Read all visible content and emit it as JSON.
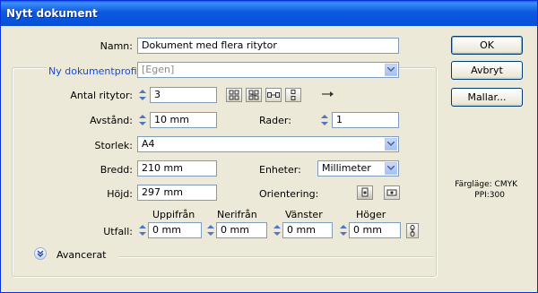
{
  "window": {
    "title": "Nytt dokument"
  },
  "name": {
    "label": "Namn:",
    "value": "Dokument med flera ritytor"
  },
  "profile": {
    "label": "Ny dokumentprofil:",
    "value": "[Egen]"
  },
  "artboards": {
    "label": "Antal ritytor:",
    "value": "3"
  },
  "spacing": {
    "label": "Avstånd:",
    "value": "10 mm"
  },
  "rows": {
    "label": "Rader:",
    "value": "1"
  },
  "size": {
    "label": "Storlek:",
    "value": "A4"
  },
  "width": {
    "label": "Bredd:",
    "value": "210 mm"
  },
  "units": {
    "label": "Enheter:",
    "value": "Millimeter"
  },
  "height": {
    "label": "Höjd:",
    "value": "297 mm"
  },
  "orientation": {
    "label": "Orientering:"
  },
  "bleed": {
    "label": "Utfall:",
    "top_label": "Uppifrån",
    "top": "0 mm",
    "bottom_label": "Nerifrån",
    "bottom": "0 mm",
    "left_label": "Vänster",
    "left": "0 mm",
    "right_label": "Höger",
    "right": "0 mm"
  },
  "advanced": {
    "label": "Avancerat"
  },
  "buttons": {
    "ok": "OK",
    "cancel": "Avbryt",
    "templates": "Mallar..."
  },
  "info": {
    "color_mode": "Färgläge: CMYK",
    "ppi": "PPI:300"
  },
  "colors": {
    "titlebar": "#0a5fef",
    "dialog_bg": "#ece9d8",
    "link_blue": "#1a4bd6"
  }
}
